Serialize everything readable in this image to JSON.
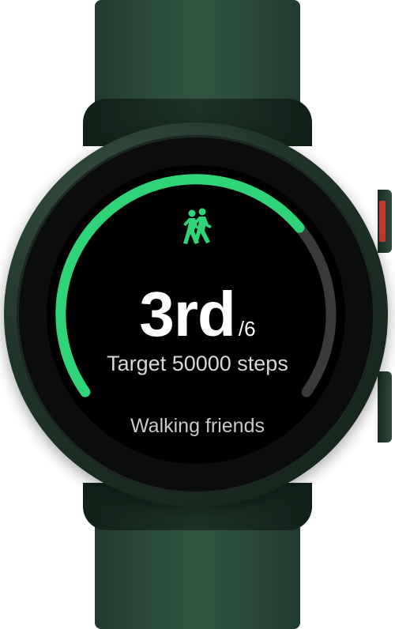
{
  "watch": {
    "rank": "3rd",
    "total": "/6",
    "target_text": "Target 50000 steps",
    "subtitle": "Walking friends",
    "icon": "walking-friends-icon",
    "progress_fraction": 0.5,
    "colors": {
      "accent": "#2ED477",
      "track": "#3a3a3a",
      "strap": "#2b4a3b",
      "screen": "#000000",
      "crown_accent": "#c0392b"
    }
  }
}
